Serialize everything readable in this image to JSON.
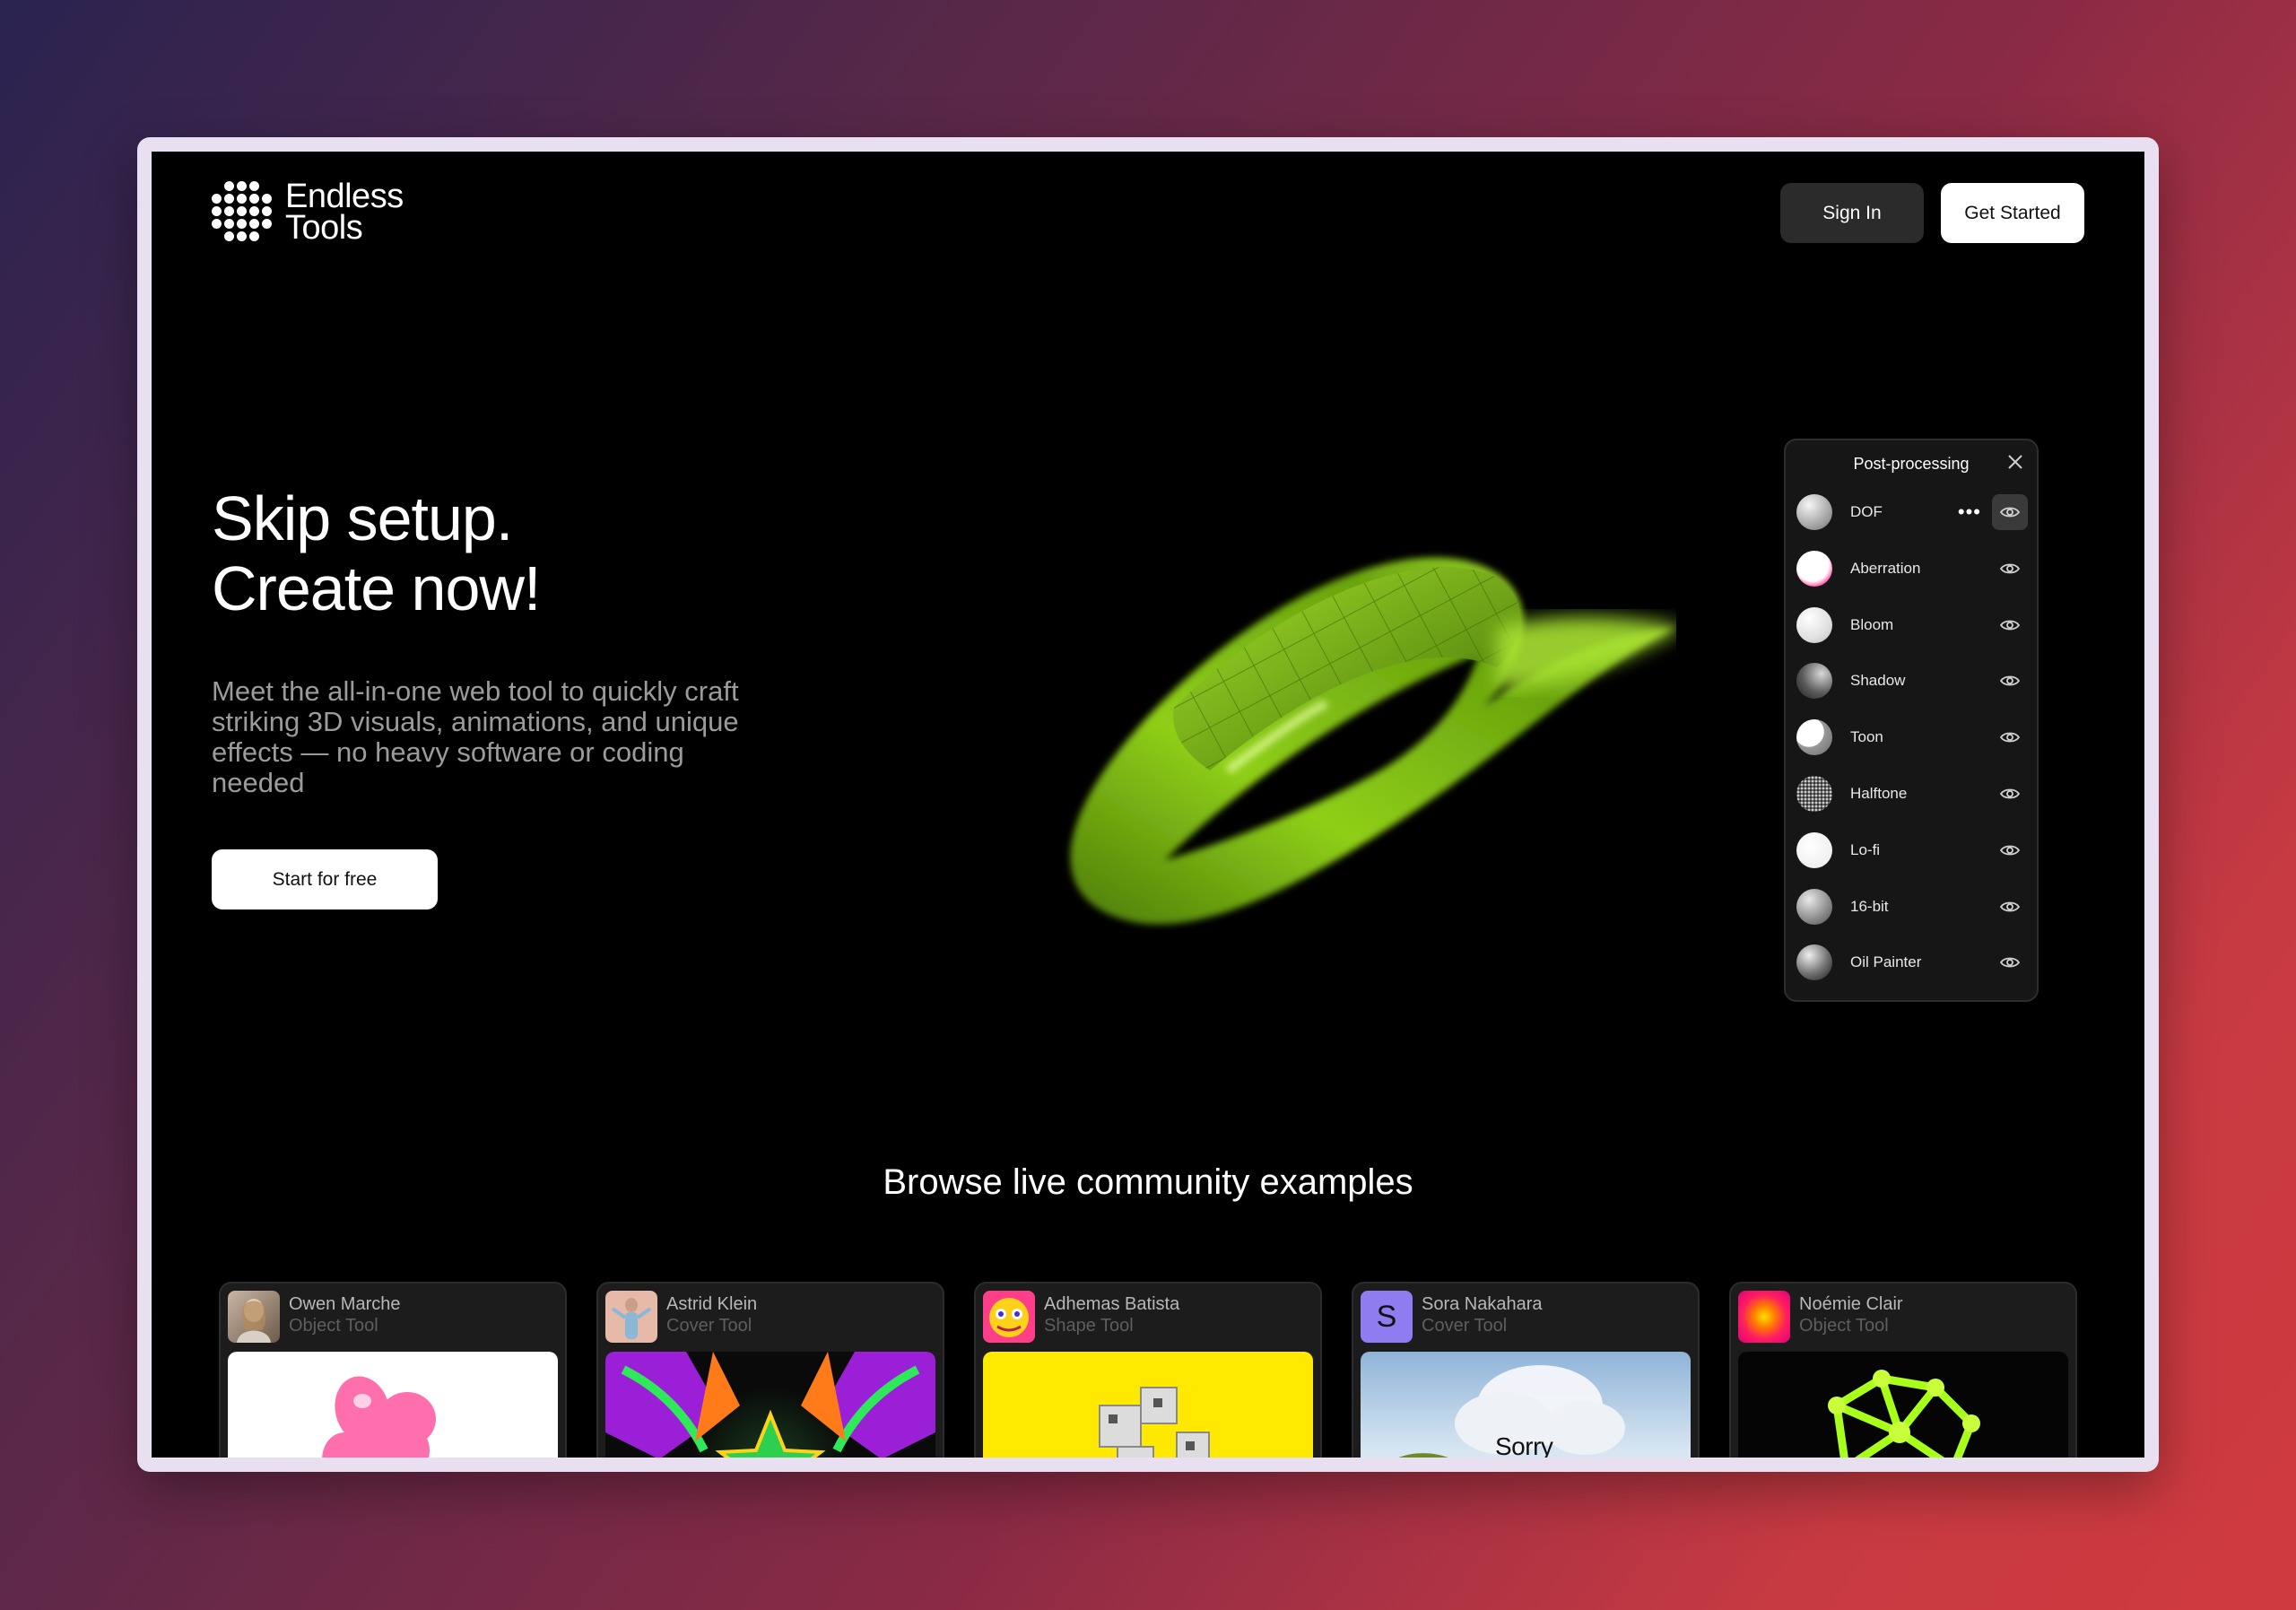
{
  "app": {
    "name_line1": "Endless",
    "name_line2": "Tools"
  },
  "header": {
    "sign_in_label": "Sign In",
    "get_started_label": "Get Started"
  },
  "hero": {
    "title_line1": "Skip setup.",
    "title_line2": "Create now!",
    "description": "Meet the all-in-one web tool to quickly craft striking 3D visuals, animations, and unique effects — no heavy software or coding needed",
    "cta_label": "Start for free"
  },
  "panel": {
    "title": "Post-processing",
    "items": [
      {
        "label": "DOF",
        "icon": "eye-icon",
        "active": true
      },
      {
        "label": "Aberration",
        "icon": "eye-icon"
      },
      {
        "label": "Bloom",
        "icon": "eye-icon"
      },
      {
        "label": "Shadow",
        "icon": "eye-icon"
      },
      {
        "label": "Toon",
        "icon": "eye-icon"
      },
      {
        "label": "Halftone",
        "icon": "eye-icon"
      },
      {
        "label": "Lo-fi",
        "icon": "eye-icon"
      },
      {
        "label": "16-bit",
        "icon": "eye-icon"
      },
      {
        "label": "Oil Painter",
        "icon": "eye-icon"
      }
    ],
    "more_glyph": "•••"
  },
  "browse": {
    "title": "Browse live community examples",
    "cards": [
      {
        "name": "Owen Marche",
        "tool": "Object Tool"
      },
      {
        "name": "Astrid Klein",
        "tool": "Cover Tool"
      },
      {
        "name": "Adhemas Batista",
        "tool": "Shape Tool"
      },
      {
        "name": "Sora Nakahara",
        "tool": "Cover Tool",
        "avatar_letter": "S",
        "image_text": "Sorry"
      },
      {
        "name": "Noémie Clair",
        "tool": "Object Tool"
      }
    ]
  },
  "colors": {
    "accent_green": "#9bd61e",
    "background": "#000000",
    "panel_bg": "#161616"
  }
}
